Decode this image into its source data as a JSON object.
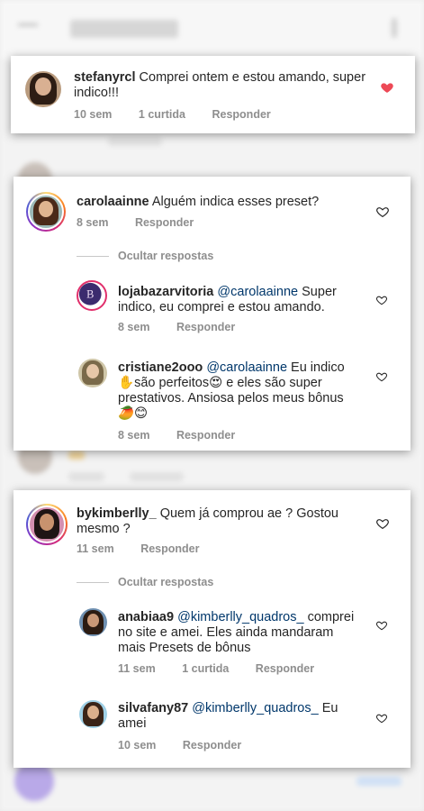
{
  "background": {
    "header_title": "Publicação"
  },
  "card1": {
    "username": "stefanyrcl",
    "text": "Comprei ontem e estou amando, super indico!!!",
    "time": "10 sem",
    "likes": "1 curtida",
    "reply": "Responder",
    "liked": true
  },
  "card2": {
    "username": "carolaainne",
    "text": "Alguém indica esses preset?",
    "time": "8 sem",
    "reply": "Responder",
    "hide_replies": "Ocultar respostas",
    "replies": [
      {
        "username": "lojabazarvitoria",
        "mention": "@carolaainne",
        "text": "Super indico, eu comprei e estou amando.",
        "time": "8 sem",
        "reply": "Responder"
      },
      {
        "username": "cristiane2ooo",
        "mention": "@carolaainne",
        "text_a": "Eu indico",
        "emoji_a": "✋",
        "text_b": "são perfeitos",
        "emoji_b": "😍",
        "text_c": "e eles são super prestativos. Ansiosa pelos meus bônus",
        "emoji_c": "🥭😊",
        "time": "8 sem",
        "reply": "Responder"
      }
    ]
  },
  "card3": {
    "username": "bykimberlly_",
    "text": "Quem já comprou ae ?  Gostou mesmo ?",
    "time": "11 sem",
    "reply": "Responder",
    "hide_replies": "Ocultar respostas",
    "replies": [
      {
        "username": "anabiaa9",
        "mention": "@kimberlly_quadros_",
        "text": "comprei no site e amei. Eles ainda mandaram mais Presets de bônus",
        "time": "11 sem",
        "likes": "1 curtida",
        "reply": "Responder"
      },
      {
        "username": "silvafany87",
        "mention": "@kimberlly_quadros_",
        "text": "Eu amei",
        "time": "10 sem",
        "reply": "Responder"
      }
    ]
  },
  "colors": {
    "like_red": "#ed4956",
    "meta_gray": "#8e8e8e",
    "mention_blue": "#00376b"
  }
}
